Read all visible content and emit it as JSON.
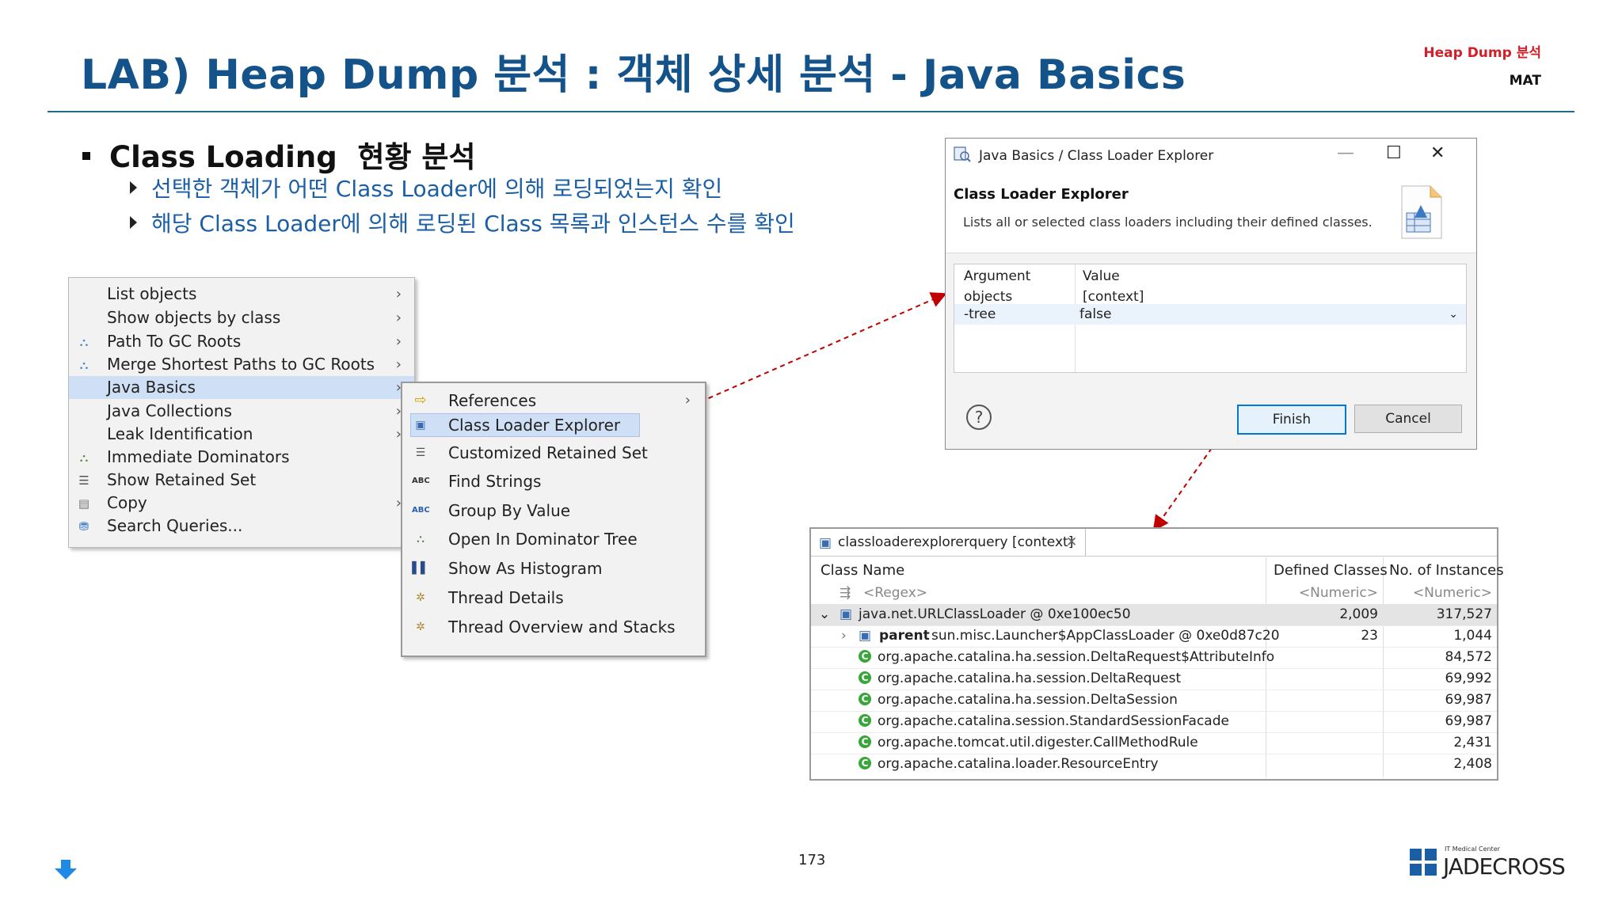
{
  "slide": {
    "title": "LAB) Heap Dump 분석 : 객체 상세 분석 - Java Basics",
    "header_tag": "Heap Dump 분석",
    "header_sub": "MAT",
    "bullet": "Class Loading  현황 분석",
    "sub_bullets": [
      "선택한 객체가 어떤 Class Loader에 의해 로딩되었는지 확인",
      "해당 Class Loader에 의해 로딩된 Class 목록과 인스턴스 수를 확인"
    ],
    "page_number": "173",
    "logo_small": "IT Medical Center",
    "logo_text": "JADECROSS"
  },
  "menu1": {
    "items": [
      {
        "label": "List objects",
        "icon": "none",
        "submenu": true
      },
      {
        "label": "Show objects by class",
        "icon": "none",
        "submenu": true
      },
      {
        "label": "Path To GC Roots",
        "icon": "path-gc-icon",
        "submenu": true
      },
      {
        "label": "Merge Shortest Paths to GC Roots",
        "icon": "merge-paths-icon",
        "submenu": true
      },
      {
        "label": "Java Basics",
        "icon": "none",
        "submenu": true,
        "selected": true
      },
      {
        "label": "Java Collections",
        "icon": "none",
        "submenu": true
      },
      {
        "label": "Leak Identification",
        "icon": "none",
        "submenu": true
      },
      {
        "label": "Immediate Dominators",
        "icon": "dominators-icon",
        "submenu": false
      },
      {
        "label": "Show Retained Set",
        "icon": "retained-set-icon",
        "submenu": false
      },
      {
        "label": "Copy",
        "icon": "copy-icon",
        "submenu": true
      },
      {
        "label": "Search Queries...",
        "icon": "search-queries-icon",
        "submenu": false
      }
    ]
  },
  "menu2": {
    "items": [
      {
        "label": "References",
        "icon": "references-icon",
        "submenu": true
      },
      {
        "label": "Class Loader Explorer",
        "icon": "classloader-icon",
        "submenu": false,
        "selected": true
      },
      {
        "label": "Customized Retained Set",
        "icon": "retained-set-icon",
        "submenu": false
      },
      {
        "label": "Find Strings",
        "icon": "find-strings-icon",
        "submenu": false
      },
      {
        "label": "Group By Value",
        "icon": "group-by-value-icon",
        "submenu": false
      },
      {
        "label": "Open In Dominator Tree",
        "icon": "dominator-tree-icon",
        "submenu": false
      },
      {
        "label": "Show As Histogram",
        "icon": "histogram-icon",
        "submenu": false
      },
      {
        "label": "Thread Details",
        "icon": "thread-icon",
        "submenu": false
      },
      {
        "label": "Thread Overview and Stacks",
        "icon": "thread-icon",
        "submenu": false
      }
    ]
  },
  "dialog": {
    "window_title": "Java Basics / Class Loader Explorer",
    "heading": "Class Loader Explorer",
    "description": "Lists all or selected class loaders including their defined classes.",
    "columns": [
      "Argument",
      "Value"
    ],
    "rows": [
      {
        "arg": "objects",
        "value": "[context]"
      },
      {
        "arg": "-tree",
        "value": "false"
      }
    ],
    "finish_label": "Finish",
    "cancel_label": "Cancel",
    "help": "?"
  },
  "result": {
    "tab_label": "classloaderexplorerquery [context]",
    "columns": [
      "Class Name",
      "Defined Classes",
      "No. of Instances"
    ],
    "filter": {
      "name": "<Regex>",
      "defined": "<Numeric>",
      "instances": "<Numeric>"
    },
    "rows": [
      {
        "name": "java.net.URLClassLoader @ 0xe100ec50",
        "defined": "2,009",
        "instances": "317,527",
        "kind": "loader",
        "expanded": true
      },
      {
        "prefix": "parent",
        "name": "sun.misc.Launcher$AppClassLoader @ 0xe0d87c20",
        "defined": "23",
        "instances": "1,044",
        "kind": "parent"
      },
      {
        "name": "org.apache.catalina.ha.session.DeltaRequest$AttributeInfo",
        "defined": "",
        "instances": "84,572",
        "kind": "class"
      },
      {
        "name": "org.apache.catalina.ha.session.DeltaRequest",
        "defined": "",
        "instances": "69,992",
        "kind": "class"
      },
      {
        "name": "org.apache.catalina.ha.session.DeltaSession",
        "defined": "",
        "instances": "69,987",
        "kind": "class"
      },
      {
        "name": "org.apache.catalina.session.StandardSessionFacade",
        "defined": "",
        "instances": "69,987",
        "kind": "class"
      },
      {
        "name": "org.apache.tomcat.util.digester.CallMethodRule",
        "defined": "",
        "instances": "2,431",
        "kind": "class"
      },
      {
        "name": "org.apache.catalina.loader.ResourceEntry",
        "defined": "",
        "instances": "2,408",
        "kind": "class"
      }
    ]
  },
  "colors": {
    "title": "#14528a",
    "header_tag": "#d0202a",
    "sub_bullet": "#1a5ea6",
    "menu_selection": "#cfe0f6",
    "arrow": "#c00000"
  }
}
